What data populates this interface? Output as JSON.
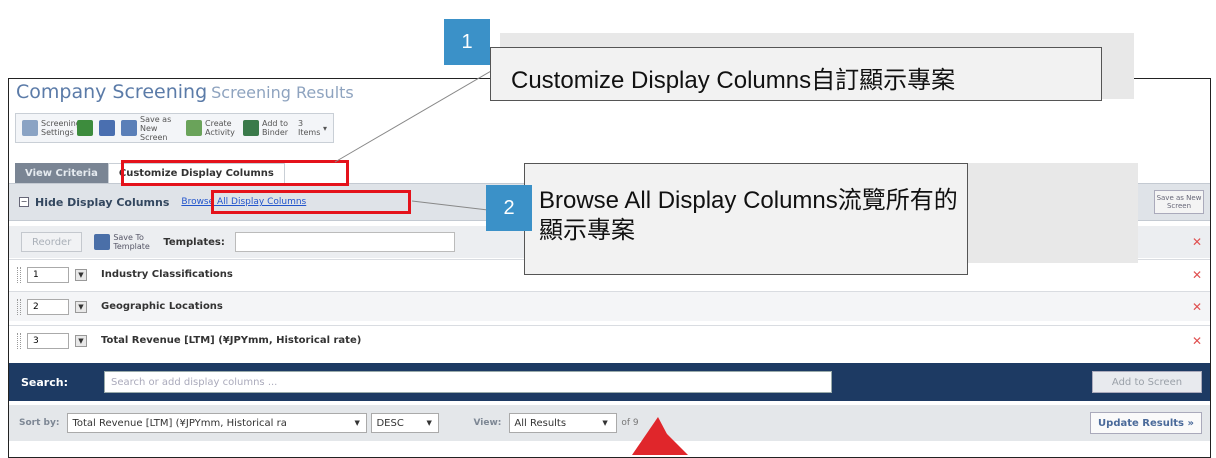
{
  "app": {
    "title": "Company Screening",
    "subtitle": "Screening Results"
  },
  "toolbar": {
    "items": [
      {
        "label": "Screening Settings"
      },
      {
        "label": ""
      },
      {
        "label": ""
      },
      {
        "label": "Save as New Screen"
      },
      {
        "label": "Create Activity"
      },
      {
        "label": "Add to Binder"
      },
      {
        "label": "3 Items"
      }
    ]
  },
  "tabs": {
    "view_criteria": "View Criteria",
    "customize": "Customize Display Columns"
  },
  "hide_bar": {
    "label": "Hide Display Columns",
    "browse": "Browse All Display Columns",
    "save_screen": "Save as New Screen"
  },
  "template_bar": {
    "reorder": "Reorder",
    "save_template": "Save To Template",
    "templates_label": "Templates:"
  },
  "columns": [
    {
      "num": "1",
      "name": "Industry Classifications"
    },
    {
      "num": "2",
      "name": "Geographic Locations"
    },
    {
      "num": "3",
      "name": "Total Revenue [LTM] (¥JPYmm, Historical rate)"
    }
  ],
  "search": {
    "label": "Search:",
    "placeholder": "Search or add display columns ...",
    "add_button": "Add to Screen"
  },
  "sort": {
    "sort_label": "Sort by:",
    "sort_value": "Total Revenue [LTM] (¥JPYmm, Historical ra",
    "order": "DESC",
    "view_label": "View:",
    "view_value": "All Results",
    "of_text": "of 9",
    "update_button": "Update Results »"
  },
  "callouts": {
    "c1_num": "1",
    "c1_text": "Customize Display Columns自訂顯示專案",
    "c2_num": "2",
    "c2_text": "Browse All Display Columns流覽所有的顯示專案"
  },
  "colors": {
    "badge": "#3b91c8",
    "highlight": "#e4121b",
    "search_bar": "#1d3a63",
    "arrow": "#e0262b"
  }
}
